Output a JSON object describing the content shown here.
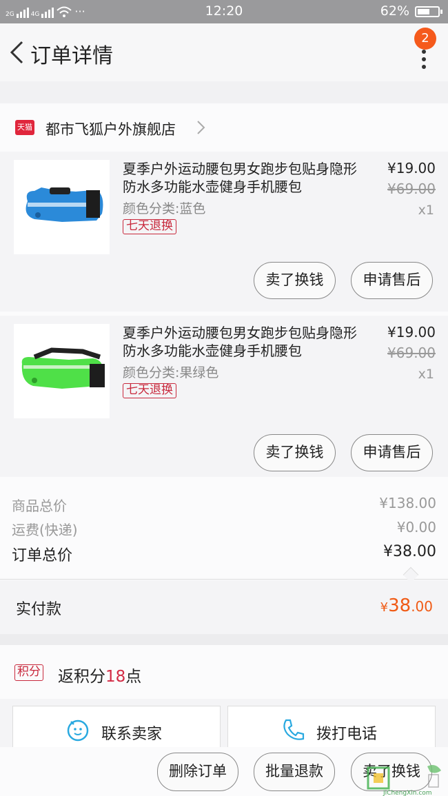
{
  "status_bar": {
    "network_1": "2G",
    "network_2": "4G",
    "dots": "···",
    "time": "12:20",
    "battery_text": "62%",
    "battery_level": 0.62
  },
  "header": {
    "title": "订单详情",
    "more_badge": "2"
  },
  "shop": {
    "tag": "天猫",
    "name": "都市飞狐户外旗舰店"
  },
  "items": [
    {
      "title": "夏季户外运动腰包男女跑步包贴身隐形防水多功能水壶健身手机腰包",
      "spec": "颜色分类:蓝色",
      "badge": "七天退换",
      "price": "¥19.00",
      "original_price": "¥69.00",
      "qty": "x1",
      "btn_sell": "卖了换钱",
      "btn_after_sale": "申请售后",
      "thumb_color": "#2b8ad9"
    },
    {
      "title": "夏季户外运动腰包男女跑步包贴身隐形防水多功能水壶健身手机腰包",
      "spec": "颜色分类:果绿色",
      "badge": "七天退换",
      "price": "¥19.00",
      "original_price": "¥69.00",
      "qty": "x1",
      "btn_sell": "卖了换钱",
      "btn_after_sale": "申请售后",
      "thumb_color": "#4fe048"
    }
  ],
  "summary": {
    "goods_total_label": "商品总价",
    "goods_total_value": "¥138.00",
    "shipping_label": "运费(快递)",
    "shipping_value": "¥0.00",
    "order_total_label": "订单总价",
    "order_total_value": "¥38.00"
  },
  "paid": {
    "label": "实付款",
    "currency": "¥",
    "integer": "38",
    "decimal": ".00"
  },
  "points": {
    "tag": "积分",
    "prefix": "返积分",
    "number": "18",
    "suffix": "点"
  },
  "contact": {
    "seller_label": "联系卖家",
    "phone_label": "拨打电话"
  },
  "bottom_actions": {
    "delete": "删除订单",
    "batch_refund": "批量退款",
    "sell": "卖了换钱"
  },
  "watermark": {
    "text": "JiChengXin.com"
  },
  "colors": {
    "accent_orange": "#f05a14",
    "tmall_red": "#e0263c",
    "points_red": "#d32b45"
  }
}
